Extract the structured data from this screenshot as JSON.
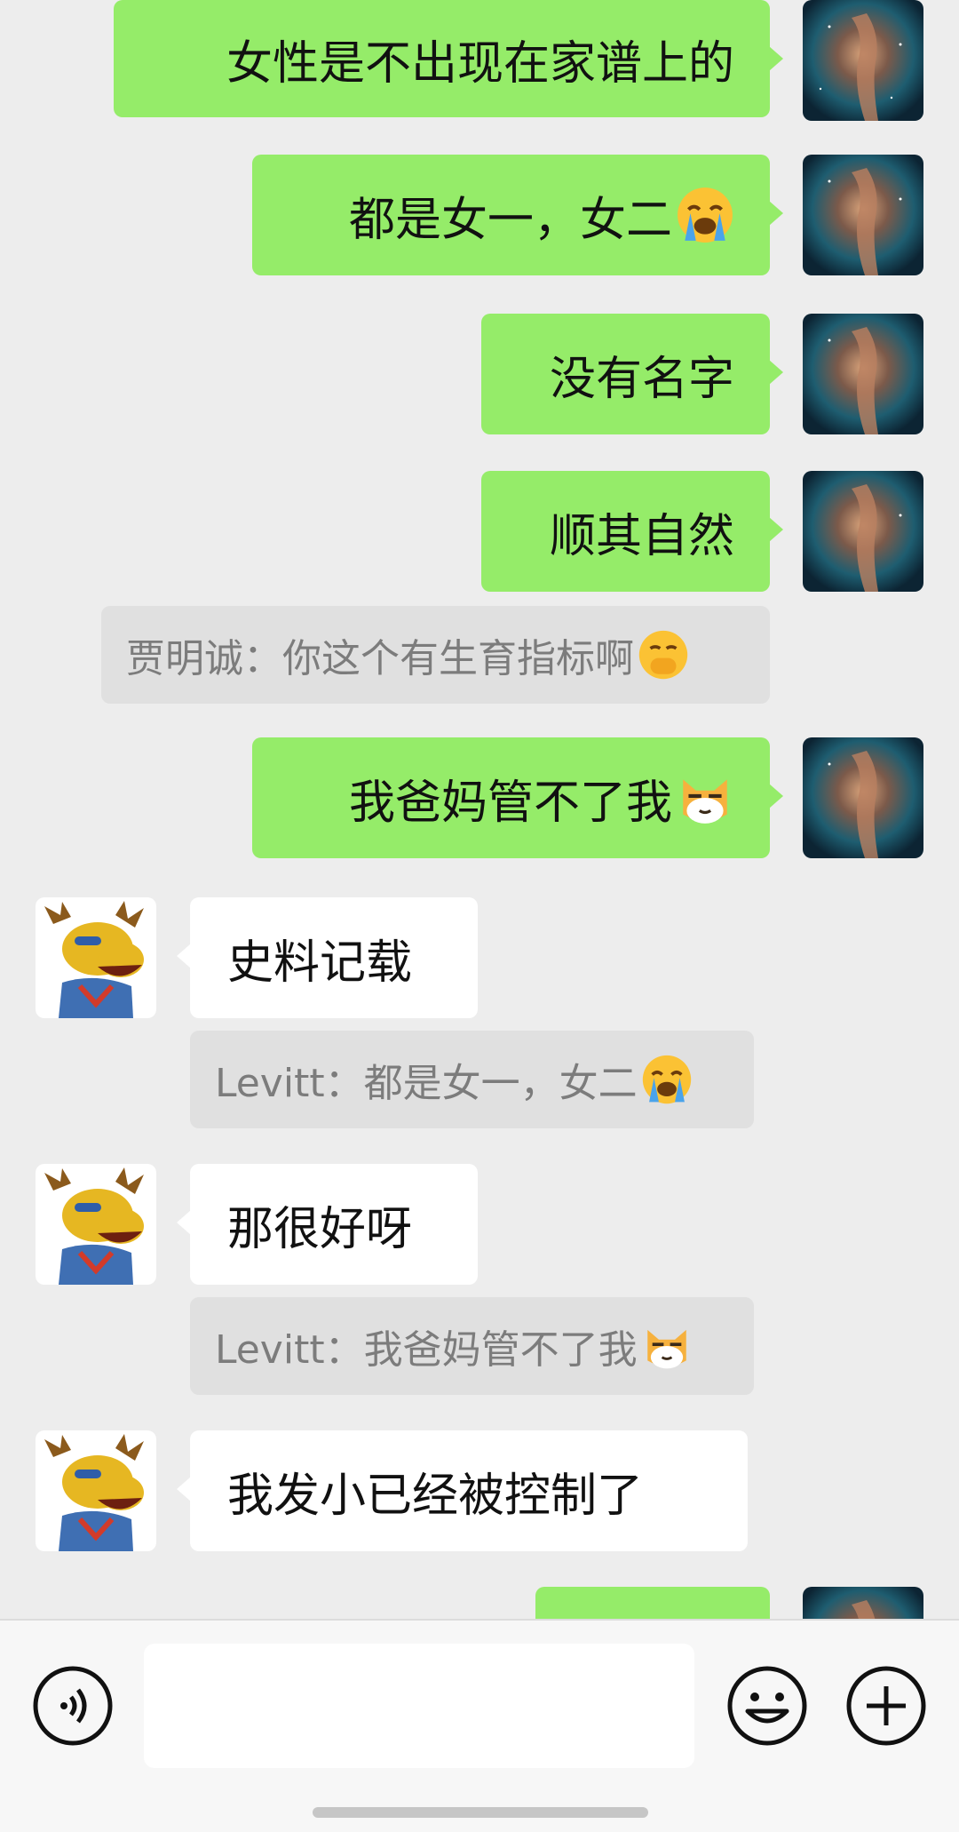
{
  "messages": [
    {
      "side": "right",
      "text": "女性是不出现在家谱上的"
    },
    {
      "side": "right",
      "text": "都是女一，女二",
      "emoji": "loudly-crying-face"
    },
    {
      "side": "right",
      "text": "没有名字"
    },
    {
      "side": "right",
      "text": "顺其自然"
    },
    {
      "type": "quote",
      "text": "贾明诚：你这个有生育指标啊",
      "emoji": "face-with-hand-over-mouth"
    },
    {
      "side": "right",
      "text": "我爸妈管不了我",
      "emoji": "smug-doge-cat"
    },
    {
      "side": "left",
      "text": "史料记载",
      "quote": {
        "text": "Levitt：都是女一，女二",
        "emoji": "loudly-crying-face"
      }
    },
    {
      "side": "left",
      "text": "那很好呀",
      "quote": {
        "text": "Levitt：我爸妈管不了我",
        "emoji": "smug-doge-cat"
      }
    },
    {
      "side": "left",
      "text": "我发小已经被控制了"
    }
  ],
  "colors": {
    "my_bubble": "#95ec69",
    "their_bubble": "#ffffff",
    "quote_bg": "#e0e0e0",
    "background": "#ededed"
  },
  "input_bar": {
    "voice_icon": "voice-icon",
    "emoji_icon": "emoji-icon",
    "plus_icon": "plus-icon"
  }
}
